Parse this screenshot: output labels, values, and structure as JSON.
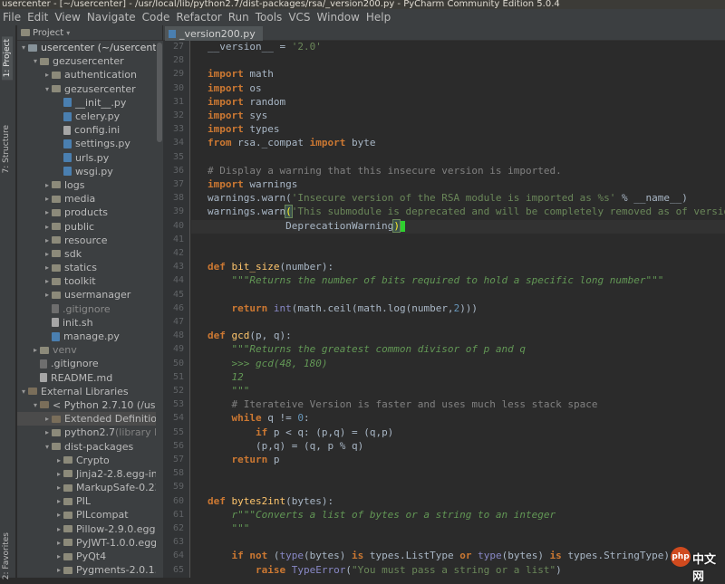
{
  "window": {
    "title": "usercenter - [~/usercenter] - /usr/local/lib/python2.7/dist-packages/rsa/_version200.py - PyCharm Community Edition 5.0.4"
  },
  "menu": [
    "File",
    "Edit",
    "View",
    "Navigate",
    "Code",
    "Refactor",
    "Run",
    "Tools",
    "VCS",
    "Window",
    "Help"
  ],
  "side_tabs": {
    "project": "1: Project",
    "structure": "7: Structure",
    "favorites": "2: Favorites"
  },
  "project_panel": {
    "title": "Project"
  },
  "editor": {
    "active_tab": "_version200.py"
  },
  "tree": [
    {
      "indent": 0,
      "arrow": "▾",
      "icon": "module",
      "label": "usercenter (~/usercenter",
      "bold": true
    },
    {
      "indent": 1,
      "arrow": "▾",
      "icon": "folder",
      "label": "gezusercenter"
    },
    {
      "indent": 2,
      "arrow": "▸",
      "icon": "folder",
      "label": "authentication"
    },
    {
      "indent": 2,
      "arrow": "▾",
      "icon": "folder",
      "label": "gezusercenter"
    },
    {
      "indent": 3,
      "arrow": "",
      "icon": "py",
      "label": "__init__.py"
    },
    {
      "indent": 3,
      "arrow": "",
      "icon": "py",
      "label": "celery.py"
    },
    {
      "indent": 3,
      "arrow": "",
      "icon": "file",
      "label": "config.ini"
    },
    {
      "indent": 3,
      "arrow": "",
      "icon": "py",
      "label": "settings.py"
    },
    {
      "indent": 3,
      "arrow": "",
      "icon": "py",
      "label": "urls.py"
    },
    {
      "indent": 3,
      "arrow": "",
      "icon": "py",
      "label": "wsgi.py"
    },
    {
      "indent": 2,
      "arrow": "▸",
      "icon": "folder",
      "label": "logs"
    },
    {
      "indent": 2,
      "arrow": "▸",
      "icon": "folder",
      "label": "media"
    },
    {
      "indent": 2,
      "arrow": "▸",
      "icon": "folder",
      "label": "products"
    },
    {
      "indent": 2,
      "arrow": "▸",
      "icon": "folder",
      "label": "public"
    },
    {
      "indent": 2,
      "arrow": "▸",
      "icon": "folder",
      "label": "resource"
    },
    {
      "indent": 2,
      "arrow": "▸",
      "icon": "folder",
      "label": "sdk"
    },
    {
      "indent": 2,
      "arrow": "▸",
      "icon": "folder",
      "label": "statics"
    },
    {
      "indent": 2,
      "arrow": "▸",
      "icon": "folder",
      "label": "toolkit"
    },
    {
      "indent": 2,
      "arrow": "▸",
      "icon": "folder",
      "label": "usermanager"
    },
    {
      "indent": 2,
      "arrow": "",
      "icon": "dot",
      "label": ".gitignore",
      "muted": true
    },
    {
      "indent": 2,
      "arrow": "",
      "icon": "file",
      "label": "init.sh"
    },
    {
      "indent": 2,
      "arrow": "",
      "icon": "py",
      "label": "manage.py"
    },
    {
      "indent": 1,
      "arrow": "▸",
      "icon": "folder",
      "label": "venv",
      "muted": true
    },
    {
      "indent": 1,
      "arrow": "",
      "icon": "dot",
      "label": ".gitignore"
    },
    {
      "indent": 1,
      "arrow": "",
      "icon": "file",
      "label": "README.md"
    },
    {
      "indent": 0,
      "arrow": "▾",
      "icon": "lib",
      "label": "External Libraries"
    },
    {
      "indent": 1,
      "arrow": "▾",
      "icon": "lib",
      "label": "< Python 2.7.10 (/usr/bi"
    },
    {
      "indent": 2,
      "arrow": "▸",
      "icon": "lib",
      "label": "Extended Definitions",
      "sel": true
    },
    {
      "indent": 2,
      "arrow": "▸",
      "icon": "folder",
      "label": "python2.7",
      "suffix": " (library ho"
    },
    {
      "indent": 2,
      "arrow": "▾",
      "icon": "folder",
      "label": "dist-packages"
    },
    {
      "indent": 3,
      "arrow": "▸",
      "icon": "folder",
      "label": "Crypto"
    },
    {
      "indent": 3,
      "arrow": "▸",
      "icon": "folder",
      "label": "Jinja2-2.8.egg-info"
    },
    {
      "indent": 3,
      "arrow": "▸",
      "icon": "folder",
      "label": "MarkupSafe-0.23.e"
    },
    {
      "indent": 3,
      "arrow": "▸",
      "icon": "folder",
      "label": "PIL"
    },
    {
      "indent": 3,
      "arrow": "▸",
      "icon": "folder",
      "label": "PILcompat"
    },
    {
      "indent": 3,
      "arrow": "▸",
      "icon": "folder",
      "label": "Pillow-2.9.0.egg-in"
    },
    {
      "indent": 3,
      "arrow": "▸",
      "icon": "folder",
      "label": "PyJWT-1.0.0.egg-in"
    },
    {
      "indent": 3,
      "arrow": "▸",
      "icon": "folder",
      "label": "PyQt4"
    },
    {
      "indent": 3,
      "arrow": "▸",
      "icon": "folder",
      "label": "Pygments-2.0.1.eg"
    }
  ],
  "code_lines": [
    {
      "n": "27",
      "t": [
        [
          "id",
          "__version__ = "
        ],
        [
          "str",
          "'2.0'"
        ]
      ]
    },
    {
      "n": "28",
      "t": []
    },
    {
      "n": "29",
      "t": [
        [
          "kw",
          "import"
        ],
        [
          "id",
          " math"
        ]
      ]
    },
    {
      "n": "30",
      "t": [
        [
          "kw",
          "import"
        ],
        [
          "id",
          " os"
        ]
      ]
    },
    {
      "n": "31",
      "t": [
        [
          "kw",
          "import"
        ],
        [
          "id",
          " random"
        ]
      ]
    },
    {
      "n": "32",
      "t": [
        [
          "kw",
          "import"
        ],
        [
          "id",
          " sys"
        ]
      ]
    },
    {
      "n": "33",
      "t": [
        [
          "kw",
          "import"
        ],
        [
          "id",
          " types"
        ]
      ]
    },
    {
      "n": "34",
      "t": [
        [
          "kw",
          "from"
        ],
        [
          "id",
          " rsa._compat "
        ],
        [
          "kw",
          "import"
        ],
        [
          "id",
          " byte"
        ]
      ]
    },
    {
      "n": "35",
      "t": []
    },
    {
      "n": "36",
      "t": [
        [
          "cm",
          "# Display a warning that this insecure version is imported."
        ]
      ]
    },
    {
      "n": "37",
      "t": [
        [
          "kw",
          "import"
        ],
        [
          "id",
          " warnings"
        ]
      ]
    },
    {
      "n": "38",
      "t": [
        [
          "id",
          "warnings.warn("
        ],
        [
          "str",
          "'Insecure version of the RSA module is imported as %s'"
        ],
        [
          "id",
          " % __name__)"
        ]
      ]
    },
    {
      "n": "39",
      "t": [
        [
          "id",
          "warnings.warn"
        ],
        [
          "mark",
          "("
        ],
        [
          "str",
          "'This submodule is deprecated and will be completely removed as of versio"
        ]
      ]
    },
    {
      "n": "40",
      "t": [
        [
          "id",
          "             DeprecationWarning"
        ],
        [
          "mark",
          ")"
        ],
        [
          "caret",
          ""
        ]
      ],
      "current": true
    },
    {
      "n": "41",
      "t": []
    },
    {
      "n": "42",
      "t": []
    },
    {
      "n": "43",
      "t": [
        [
          "kw",
          "def"
        ],
        [
          "id",
          " "
        ],
        [
          "fn",
          "bit_size"
        ],
        [
          "id",
          "(number):"
        ]
      ]
    },
    {
      "n": "44",
      "t": [
        [
          "id",
          "    "
        ],
        [
          "doc",
          "\"\"\"Returns the number of bits required to hold a specific long number\"\"\""
        ]
      ]
    },
    {
      "n": "45",
      "t": []
    },
    {
      "n": "46",
      "t": [
        [
          "id",
          "    "
        ],
        [
          "kw",
          "return"
        ],
        [
          "id",
          " "
        ],
        [
          "bi",
          "int"
        ],
        [
          "id",
          "(math.ceil(math.log(number,"
        ],
        [
          "num",
          "2"
        ],
        [
          "id",
          ")))"
        ]
      ]
    },
    {
      "n": "47",
      "t": []
    },
    {
      "n": "48",
      "t": [
        [
          "kw",
          "def"
        ],
        [
          "id",
          " "
        ],
        [
          "fn",
          "gcd"
        ],
        [
          "id",
          "(p, q):"
        ]
      ]
    },
    {
      "n": "49",
      "t": [
        [
          "id",
          "    "
        ],
        [
          "doc",
          "\"\"\"Returns the greatest common divisor of p and q"
        ]
      ]
    },
    {
      "n": "50",
      "t": [
        [
          "doc",
          "    >>> gcd(48, 180)"
        ]
      ]
    },
    {
      "n": "51",
      "t": [
        [
          "doc",
          "    12"
        ]
      ]
    },
    {
      "n": "52",
      "t": [
        [
          "doc",
          "    \"\"\""
        ]
      ]
    },
    {
      "n": "53",
      "t": [
        [
          "id",
          "    "
        ],
        [
          "cm",
          "# Iterateive Version is faster and uses much less stack space"
        ]
      ]
    },
    {
      "n": "54",
      "t": [
        [
          "id",
          "    "
        ],
        [
          "kw",
          "while"
        ],
        [
          "id",
          " q != "
        ],
        [
          "num",
          "0"
        ],
        [
          "id",
          ":"
        ]
      ]
    },
    {
      "n": "55",
      "t": [
        [
          "id",
          "        "
        ],
        [
          "kw",
          "if"
        ],
        [
          "id",
          " p < q: (p,q) = (q,p)"
        ]
      ]
    },
    {
      "n": "56",
      "t": [
        [
          "id",
          "        (p,q) = (q, p % q)"
        ]
      ]
    },
    {
      "n": "57",
      "t": [
        [
          "id",
          "    "
        ],
        [
          "kw",
          "return"
        ],
        [
          "id",
          " p"
        ]
      ]
    },
    {
      "n": "58",
      "t": []
    },
    {
      "n": "59",
      "t": []
    },
    {
      "n": "60",
      "t": [
        [
          "kw",
          "def"
        ],
        [
          "id",
          " "
        ],
        [
          "fn",
          "bytes2int"
        ],
        [
          "id",
          "(bytes):"
        ]
      ]
    },
    {
      "n": "61",
      "t": [
        [
          "id",
          "    "
        ],
        [
          "doc",
          "r\"\"\"Converts a list of bytes or a string to an integer"
        ]
      ]
    },
    {
      "n": "62",
      "t": [
        [
          "doc",
          "    \"\"\""
        ]
      ]
    },
    {
      "n": "63",
      "t": []
    },
    {
      "n": "64",
      "t": [
        [
          "id",
          "    "
        ],
        [
          "kw",
          "if not"
        ],
        [
          "id",
          " ("
        ],
        [
          "bi",
          "type"
        ],
        [
          "id",
          "(bytes) "
        ],
        [
          "kw",
          "is"
        ],
        [
          "id",
          " types.ListType "
        ],
        [
          "kw",
          "or"
        ],
        [
          "id",
          " "
        ],
        [
          "bi",
          "type"
        ],
        [
          "id",
          "(bytes) "
        ],
        [
          "kw",
          "is"
        ],
        [
          "id",
          " types.StringType):"
        ]
      ]
    },
    {
      "n": "65",
      "t": [
        [
          "id",
          "        "
        ],
        [
          "kw",
          "raise"
        ],
        [
          "id",
          " "
        ],
        [
          "bi",
          "TypeError"
        ],
        [
          "id",
          "("
        ],
        [
          "str",
          "\"You must pass a string or a list\""
        ],
        [
          "id",
          ")"
        ]
      ]
    }
  ],
  "watermark": {
    "logo": "php",
    "text": "中文网"
  }
}
